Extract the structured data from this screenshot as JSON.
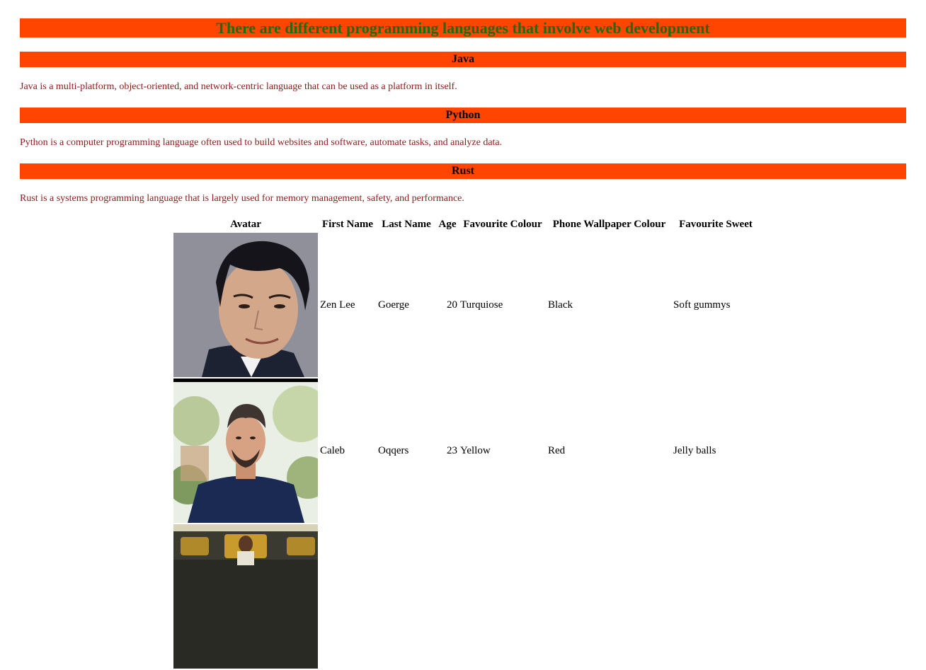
{
  "page": {
    "title": "There are different programming languages that involve web development"
  },
  "sections": [
    {
      "heading": "Java",
      "text": "Java is a multi-platform, object-oriented, and network-centric language that can be used as a platform in itself."
    },
    {
      "heading": "Python",
      "text": "Python is a computer programming language often used to build websites and software, automate tasks, and analyze data."
    },
    {
      "heading": "Rust",
      "text": "Rust is a systems programming language that is largely used for memory management, safety, and performance."
    }
  ],
  "table": {
    "headers": [
      "Avatar",
      "First Name",
      "Last Name",
      "Age",
      "Favourite Colour",
      "Phone Wallpaper Colour",
      "Favourite Sweet"
    ],
    "rows": [
      {
        "avatar": "man-portrait-dark-hair-photo",
        "first": "Zen Lee",
        "last": "Goerge",
        "age": "20",
        "colour": "Turquiose",
        "wallpaper": "Black",
        "sweet": "Soft gummys"
      },
      {
        "avatar": "man-portrait-navy-sweater-photo",
        "first": "Caleb",
        "last": "Oqqers",
        "age": "23",
        "colour": "Yellow",
        "wallpaper": "Red",
        "sweet": "Jelly balls"
      },
      {
        "avatar": "boxing-event-photo",
        "first": "",
        "last": "",
        "age": "",
        "colour": "",
        "wallpaper": "",
        "sweet": ""
      }
    ]
  },
  "colors": {
    "heading_bg": "#ff4500",
    "title_text": "#1f6b12",
    "description_text": "#8b1a1a"
  }
}
